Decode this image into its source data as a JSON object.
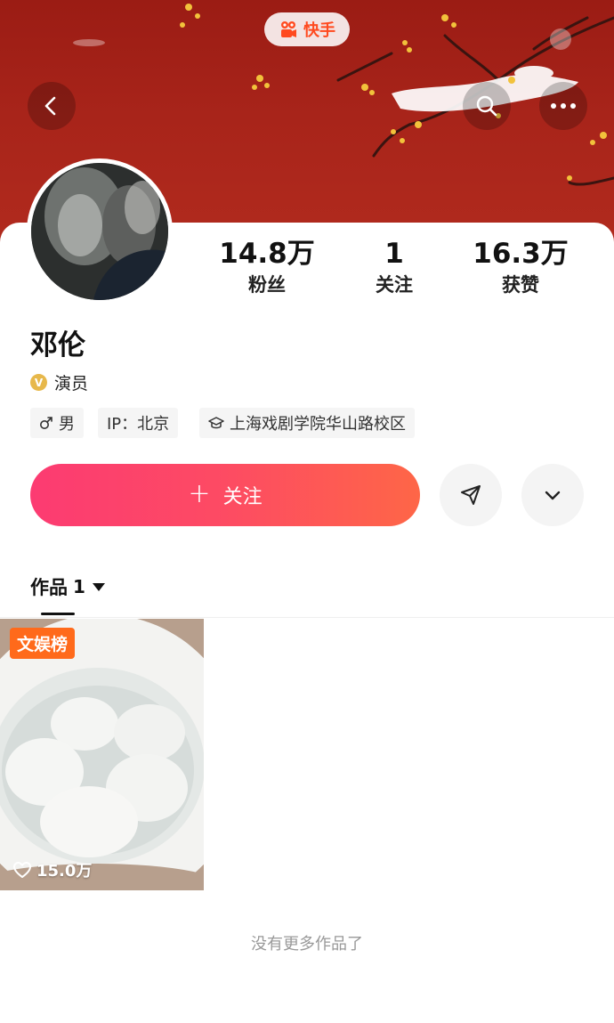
{
  "app": {
    "name": "快手"
  },
  "profile": {
    "name": "邓伦",
    "verification": "演员",
    "stats": [
      {
        "value": "14.8万",
        "label": "粉丝"
      },
      {
        "value": "1",
        "label": "关注"
      },
      {
        "value": "16.3万",
        "label": "获赞"
      }
    ],
    "tags": {
      "gender": "男",
      "ip": "IP：北京",
      "school": "上海戏剧学院华山路校区"
    }
  },
  "actions": {
    "follow_label": "关注"
  },
  "works": {
    "tab_label": "作品",
    "count": "1",
    "items": [
      {
        "badge": "文娱榜",
        "likes": "15.0万"
      }
    ],
    "end_text": "没有更多作品了"
  },
  "colors": {
    "banner": "#a8241a",
    "follow_start": "#fc3b72",
    "follow_end": "#fe6647",
    "badge": "#ff6a1b"
  }
}
